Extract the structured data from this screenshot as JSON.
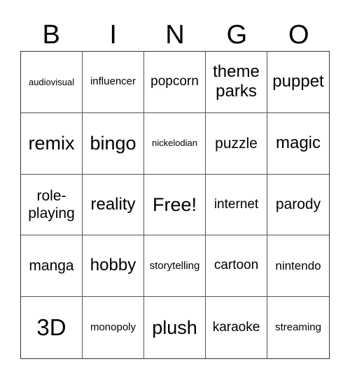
{
  "header": [
    "B",
    "I",
    "N",
    "G",
    "O"
  ],
  "cells": [
    {
      "text": "audiovisual",
      "size": "s13"
    },
    {
      "text": "influencer",
      "size": "s15"
    },
    {
      "text": "popcorn",
      "size": "s19"
    },
    {
      "text": "theme parks",
      "size": "s24"
    },
    {
      "text": "puppet",
      "size": "s24"
    },
    {
      "text": "remix",
      "size": "s27"
    },
    {
      "text": "bingo",
      "size": "s27"
    },
    {
      "text": "nickelodian",
      "size": "s13"
    },
    {
      "text": "puzzle",
      "size": "s21"
    },
    {
      "text": "magic",
      "size": "s24"
    },
    {
      "text": "role-playing",
      "size": "s21"
    },
    {
      "text": "reality",
      "size": "s24"
    },
    {
      "text": "Free!",
      "size": "s27"
    },
    {
      "text": "internet",
      "size": "s19"
    },
    {
      "text": "parody",
      "size": "s21"
    },
    {
      "text": "manga",
      "size": "s21"
    },
    {
      "text": "hobby",
      "size": "s24"
    },
    {
      "text": "storytelling",
      "size": "s15"
    },
    {
      "text": "cartoon",
      "size": "s19"
    },
    {
      "text": "nintendo",
      "size": "s17"
    },
    {
      "text": "3D",
      "size": "s33"
    },
    {
      "text": "monopoly",
      "size": "s15"
    },
    {
      "text": "plush",
      "size": "s27"
    },
    {
      "text": "karaoke",
      "size": "s19"
    },
    {
      "text": "streaming",
      "size": "s15"
    }
  ]
}
